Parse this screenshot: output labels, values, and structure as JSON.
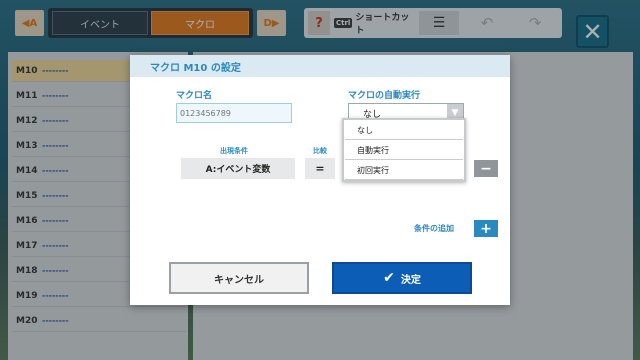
{
  "toolbar": {
    "prev_key": "A",
    "next_key": "D",
    "tabs": [
      {
        "label": "イベント"
      },
      {
        "label": "マクロ"
      }
    ],
    "help_label": "?",
    "ctrl_label": "Ctrl",
    "shortcut_label": "ショートカット",
    "list_icon": "☰",
    "undo_icon": "↶",
    "redo_icon": "↷",
    "close_icon": "✕"
  },
  "macro_list": [
    {
      "id": "M10",
      "value": "--------"
    },
    {
      "id": "M11",
      "value": "--------"
    },
    {
      "id": "M12",
      "value": "--------"
    },
    {
      "id": "M13",
      "value": "--------"
    },
    {
      "id": "M14",
      "value": "--------"
    },
    {
      "id": "M15",
      "value": "--------"
    },
    {
      "id": "M16",
      "value": "--------"
    },
    {
      "id": "M17",
      "value": "--------"
    },
    {
      "id": "M18",
      "value": "--------"
    },
    {
      "id": "M19",
      "value": "--------"
    },
    {
      "id": "M20",
      "value": "--------"
    }
  ],
  "dialog": {
    "title": "マクロ M10 の設定",
    "name_label": "マクロ名",
    "name_placeholder": "0123456789",
    "auto_label": "マクロの自動実行",
    "auto_selected": "なし",
    "auto_options": [
      "なし",
      "自動実行",
      "初回実行"
    ],
    "cond_label": "出現条件",
    "compare_label": "比較",
    "cond_value": "A:イベント変数",
    "operator": "=",
    "remove_icon": "−",
    "add_condition_label": "条件の追加",
    "add_icon": "+",
    "cancel_label": "キャンセル",
    "ok_label": "決定",
    "ok_icon": "✔"
  }
}
